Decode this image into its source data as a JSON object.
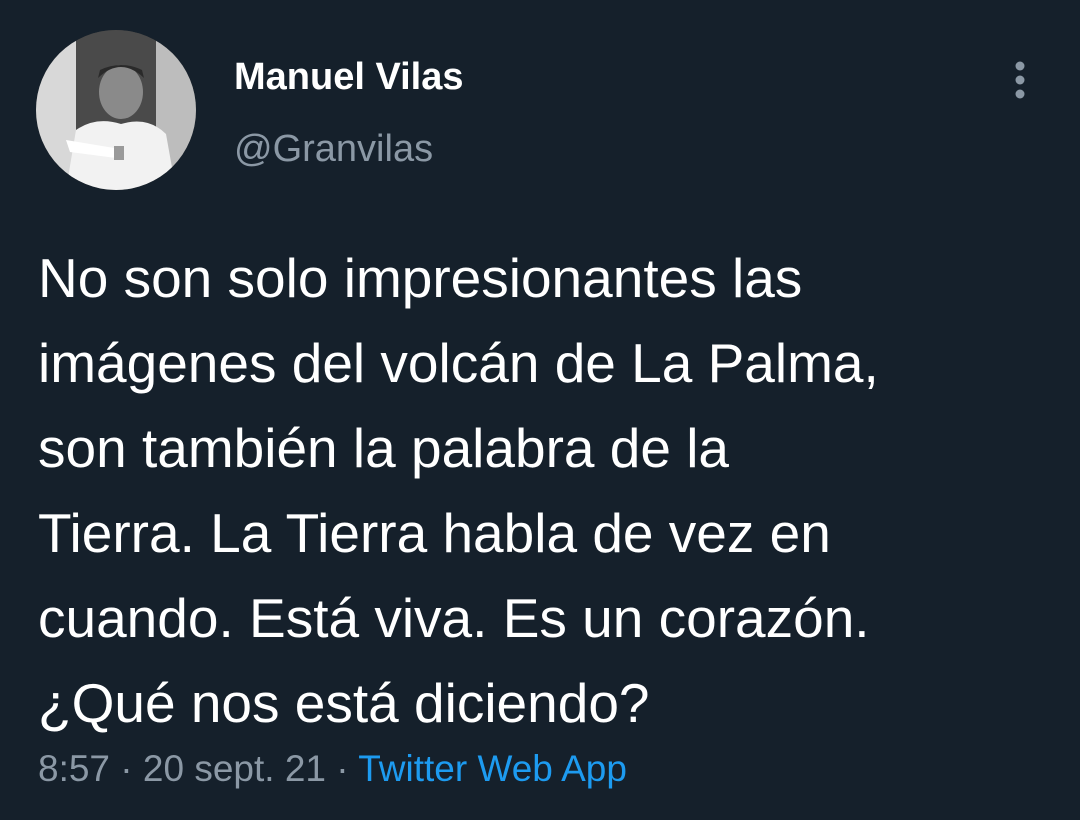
{
  "author": {
    "display_name": "Manuel Vilas",
    "handle": "@Granvilas",
    "avatar_icon": "profile-photo"
  },
  "more_icon": "more-vertical-icon",
  "tweet": {
    "text": "No son solo impresionantes las\nimágenes del volcán de La Palma,\nson también la palabra de la\nTierra. La Tierra habla de vez en\ncuando. Está viva. Es un corazón.\n¿Qué nos está diciendo?",
    "time": "8:57",
    "separator": "·",
    "date": "20 sept. 21",
    "source": "Twitter Web App"
  },
  "colors": {
    "background": "#15202b",
    "text": "#ffffff",
    "secondary_text": "#8b98a5",
    "link": "#1d9bf0"
  }
}
